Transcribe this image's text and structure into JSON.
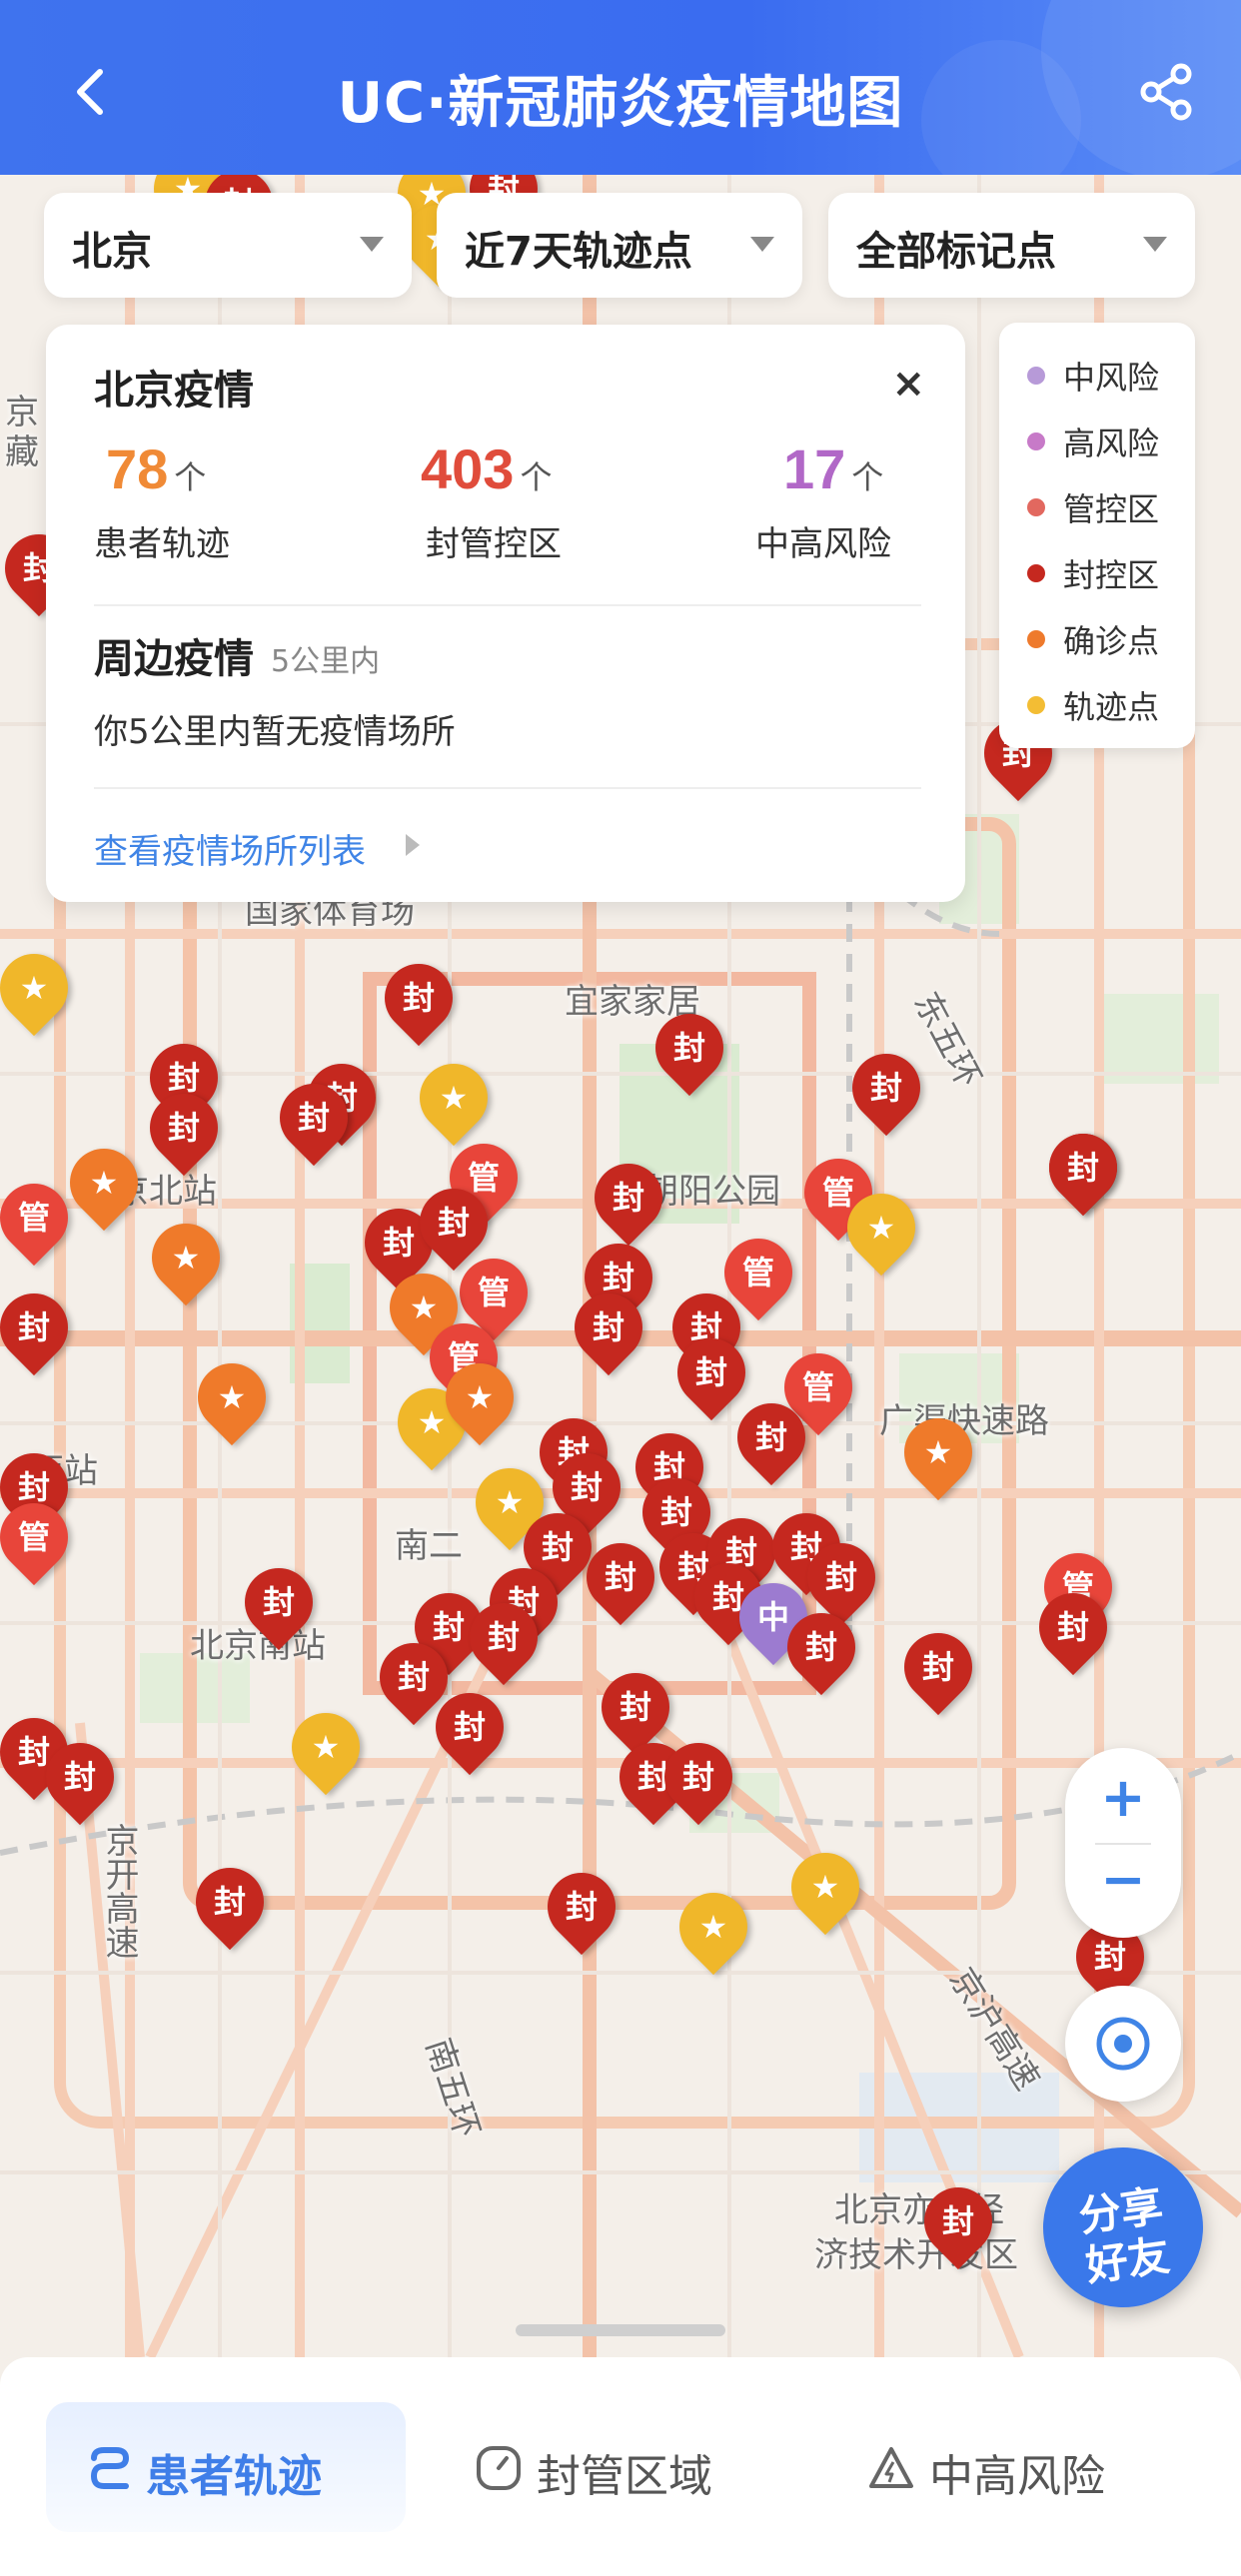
{
  "header": {
    "title": "UC·新冠肺炎疫情地图",
    "back_icon": "chevron-left-icon",
    "share_icon": "share-icon"
  },
  "filters": {
    "city": "北京",
    "range": "近7天轨迹点",
    "markers": "全部标记点"
  },
  "card": {
    "title": "北京疫情",
    "close": "×",
    "stats": [
      {
        "value": "78",
        "unit": "个",
        "label": "患者轨迹",
        "color": "#f08a36"
      },
      {
        "value": "403",
        "unit": "个",
        "label": "封管控区",
        "color": "#e04c3b"
      },
      {
        "value": "17",
        "unit": "个",
        "label": "中高风险",
        "color": "#b168c7"
      }
    ],
    "nearby_title": "周边疫情",
    "nearby_sub": "5公里内",
    "nearby_text": "你5公里内暂无疫情场所",
    "link": "查看疫情场所列表"
  },
  "legend": [
    {
      "label": "中风险",
      "color": "#b79ad8"
    },
    {
      "label": "高风险",
      "color": "#c77ac8"
    },
    {
      "label": "管控区",
      "color": "#e2685f"
    },
    {
      "label": "封控区",
      "color": "#c5281f"
    },
    {
      "label": "确诊点",
      "color": "#ee7a2c"
    },
    {
      "label": "轨迹点",
      "color": "#f3bd34"
    }
  ],
  "map_labels": {
    "yijiajiayuan": "宜家家居",
    "chaoyang_park": "朝阳公园",
    "guojia_tiyuchang": "国家体育场",
    "beijing_north": "京北站",
    "west_station": "西站",
    "beijing_south": "北京南站",
    "nan2": "南二",
    "east5": "东五环",
    "guangqu": "广渠快速路",
    "south5": "南五环",
    "jingkai": "京开高速",
    "jinghu": "京沪高速",
    "yizhuang_1": "北京亦庄经",
    "yizhuang_2": "济技术开发区",
    "jing_top": "京",
    "cang_left": "藏"
  },
  "pins": {
    "feng": "封",
    "guan": "管",
    "zhong": "中",
    "star": "★"
  },
  "controls": {
    "zoom_in": "+",
    "zoom_out": "−",
    "share_line1": "分享",
    "share_line2": "好友"
  },
  "tabs": [
    {
      "label": "患者轨迹",
      "icon": "route-icon",
      "active": true
    },
    {
      "label": "封管区域",
      "icon": "clock-icon",
      "active": false
    },
    {
      "label": "中高风险",
      "icon": "warning-icon",
      "active": false
    }
  ]
}
